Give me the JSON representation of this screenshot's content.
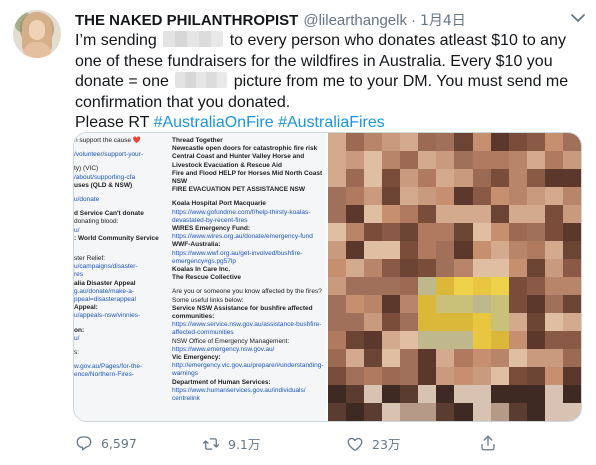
{
  "tweet": {
    "display_name": "THE NAKED PHILANTHROPIST",
    "handle": "@lilearthangelk",
    "separator": "·",
    "date": "1月4日",
    "text_lines": [
      [
        "I’m sending ",
        "[blur]",
        " to every person who donates atleast $10 to any"
      ],
      [
        "one of these fundraisers for the wildfires in Australia. Every $10 you"
      ],
      [
        "donate = one ",
        "[blur]",
        " picture from me to your DM. You must send me"
      ],
      [
        "confirmation that you donated."
      ],
      [
        "Please RT "
      ]
    ],
    "text": {
      "l1a": "I’m sending",
      "l1b": "to every person who donates atleast $10 to any",
      "l2": "one of these fundraisers for the wildfires in Australia. Every $10 you",
      "l3a": "donate = one",
      "l3b": "picture from me to your DM. You must send me",
      "l4": "confirmation that you donated.",
      "l5": "Please RT"
    },
    "hashtags": [
      "#AustraliaOnFire",
      "#AustraliaFires"
    ]
  },
  "media": {
    "left_col": [
      {
        "t": "n support the cause ❤️",
        "s": "k"
      },
      {
        "t": "",
        "s": "sp"
      },
      {
        "t": "/volunteer/support-your-",
        "s": ""
      },
      {
        "t": "",
        "s": "sp"
      },
      {
        "t": "ty) (VIC)",
        "s": "k"
      },
      {
        "t": "/about/supporting-cfa",
        "s": ""
      },
      {
        "t": "uses (QLD & NSW)",
        "s": "b"
      },
      {
        "t": "",
        "s": "sp"
      },
      {
        "t": "u/donate",
        "s": ""
      },
      {
        "t": "",
        "s": "sp"
      },
      {
        "t": "d Service Can't donate",
        "s": "b"
      },
      {
        "t": "donating blood:",
        "s": "k"
      },
      {
        "t": "u/",
        "s": ""
      },
      {
        "t": ": World Community Service",
        "s": "b"
      },
      {
        "t": "",
        "s": "sp"
      },
      {
        "t": "",
        "s": "sp"
      },
      {
        "t": "ster Relief:",
        "s": "k"
      },
      {
        "t": "u/campaigns/disaster-",
        "s": ""
      },
      {
        "t": "res",
        "s": ""
      },
      {
        "t": "alia Disaster Appeal",
        "s": "b"
      },
      {
        "t": "g.au/donate/make-a-",
        "s": ""
      },
      {
        "t": "ppeal=disasterappeal",
        "s": ""
      },
      {
        "t": "Appeal:",
        "s": "b"
      },
      {
        "t": "u/appeals-nsw/vinnies-",
        "s": ""
      },
      {
        "t": "",
        "s": "sp"
      },
      {
        "t": "on:",
        "s": "b"
      },
      {
        "t": "u/",
        "s": ""
      },
      {
        "t": "",
        "s": "sp"
      },
      {
        "t": "s:",
        "s": "k"
      },
      {
        "t": "",
        "s": "sp"
      },
      {
        "t": "w.gov.au/Pages/for-the-",
        "s": ""
      },
      {
        "t": "ence/Northern-Fires-",
        "s": ""
      }
    ],
    "right_col": [
      {
        "t": "Thread Together",
        "s": "b"
      },
      {
        "t": "Newcastle open doors for catastrophic fire risk",
        "s": "b"
      },
      {
        "t": "Central Coast and Hunter Valley Horse and",
        "s": "b"
      },
      {
        "t": "Livestock Evacuation & Rescue Aid",
        "s": "b"
      },
      {
        "t": "Fire and Flood HELP for Horses Mid North Coast",
        "s": "b"
      },
      {
        "t": "NSW",
        "s": "b"
      },
      {
        "t": "FIRE EVACUATION PET ASSISTANCE NSW",
        "s": "b"
      },
      {
        "t": "",
        "s": "sp"
      },
      {
        "t": "Koala Hospital Port Macquarie",
        "s": "b"
      },
      {
        "t": "https://www.gofundme.com/f/help-thirsty-koalas-",
        "s": ""
      },
      {
        "t": "devastated-by-recent-fires",
        "s": ""
      },
      {
        "t": "WIRES Emergency Fund:",
        "s": "b"
      },
      {
        "t": "https://www.wires.org.au/donate/emergency-fund",
        "s": ""
      },
      {
        "t": "WWF-Australia:",
        "s": "b"
      },
      {
        "t": "https://www.wwf.org.au/get-involved/bushfire-",
        "s": ""
      },
      {
        "t": "emergency#gs.pg57lp",
        "s": ""
      },
      {
        "t": "Koalas In Care Inc.",
        "s": "b"
      },
      {
        "t": "The Rescue Collective",
        "s": "b"
      },
      {
        "t": "",
        "s": "sp"
      },
      {
        "t": "Are you or someone you know affected by the fires?",
        "s": "k"
      },
      {
        "t": "Some useful links below:",
        "s": "k"
      },
      {
        "t": "Service NSW Assistance for bushfire affected",
        "s": "b"
      },
      {
        "t": "communities:",
        "s": "b"
      },
      {
        "t": "https://www.service.nsw.gov.au/assistance-bushfire-",
        "s": ""
      },
      {
        "t": "affected-communities",
        "s": ""
      },
      {
        "t": "NSW Office of Emergency Management:",
        "s": "k"
      },
      {
        "t": "https://www.emergency.nsw.gov.au/",
        "s": ""
      },
      {
        "t": "Vic Emergency:",
        "s": "b"
      },
      {
        "t": "http://emergency.vic.gov.au/prepare/#understanding-",
        "s": ""
      },
      {
        "t": "warnings",
        "s": ""
      },
      {
        "t": "Department of Human Services:",
        "s": "b"
      },
      {
        "t": "https://www.humanservices.gov.au/individuals/",
        "s": ""
      },
      {
        "t": "centrelink",
        "s": ""
      }
    ]
  },
  "actions": {
    "reply": {
      "icon": "reply-icon",
      "count": "6,597"
    },
    "retweet": {
      "icon": "retweet-icon",
      "count": "9.1万"
    },
    "like": {
      "icon": "heart-icon",
      "count": "23万"
    },
    "share": {
      "icon": "share-icon"
    }
  },
  "colors": {
    "hashtag": "#1b95e0",
    "muted": "#657786",
    "text": "#14171a"
  }
}
